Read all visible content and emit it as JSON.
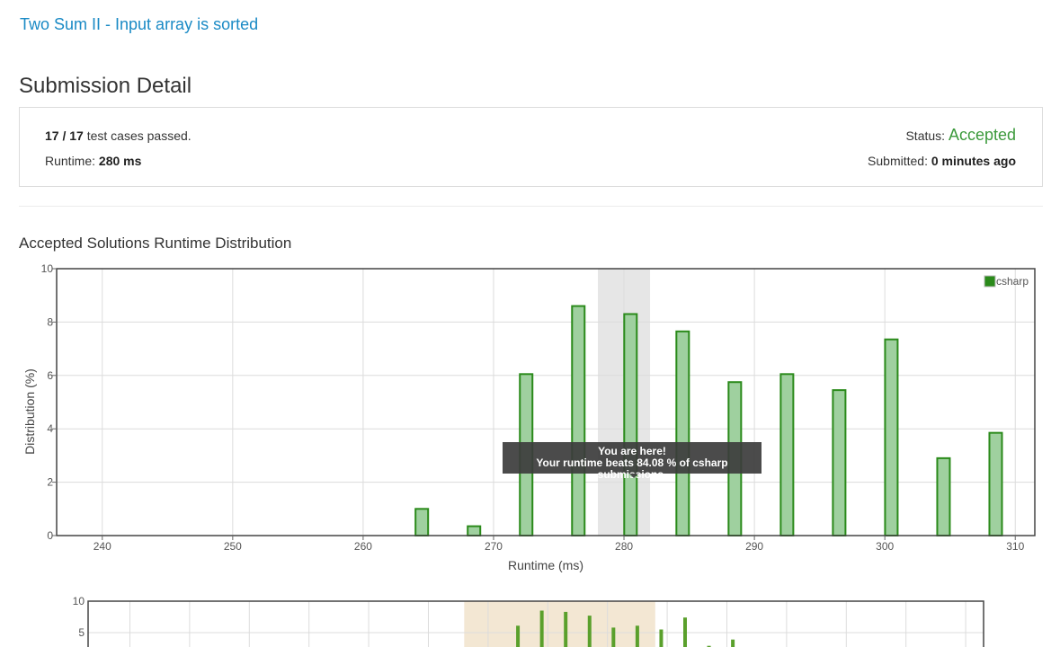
{
  "problem": {
    "title": "Two Sum II - Input array is sorted"
  },
  "page": {
    "title": "Submission Detail"
  },
  "detail": {
    "passed": "17",
    "total": "17",
    "sep": " / ",
    "cases_suffix": " test cases passed.",
    "runtime_label": "Runtime: ",
    "runtime_value": "280 ms",
    "status_label": "Status: ",
    "status_value": "Accepted",
    "submitted_label": "Submitted: ",
    "submitted_value": "0 minutes ago"
  },
  "section": {
    "title": "Accepted Solutions Runtime Distribution"
  },
  "tooltip": {
    "line1": "You are here!",
    "line2": "Your runtime beats 84.08 % of csharp submissions."
  },
  "colors": {
    "bar_fill": "#9fd09f",
    "bar_stroke": "#2a8a1a",
    "highlight_band": "#e6e6e6",
    "nav_band": "#f3e7d3",
    "nav_bar": "#5aa02c",
    "grid": "#dcdcdc"
  },
  "chart_data": [
    {
      "type": "bar",
      "title": "",
      "xlabel": "Runtime (ms)",
      "ylabel": "Distribution (%)",
      "xlim": [
        236.5,
        311.5
      ],
      "ylim": [
        0,
        10
      ],
      "xticks": [
        240,
        250,
        260,
        270,
        280,
        290,
        300,
        310
      ],
      "yticks": [
        0,
        2,
        4,
        6,
        8,
        10
      ],
      "legend": {
        "position": "top-right",
        "label": "csharp"
      },
      "highlight": {
        "from": 278,
        "to": 282
      },
      "series": [
        {
          "name": "csharp",
          "x": [
            264.5,
            268.5,
            272.5,
            276.5,
            280.5,
            284.5,
            288.5,
            292.5,
            296.5,
            300.5,
            304.5,
            308.5
          ],
          "values": [
            1.0,
            0.35,
            6.05,
            8.6,
            8.3,
            7.65,
            5.75,
            6.05,
            5.45,
            7.35,
            2.9,
            3.85
          ]
        }
      ]
    },
    {
      "type": "bar",
      "title": "",
      "ylim": [
        0,
        10
      ],
      "yticks": [
        5,
        10
      ],
      "highlight": {
        "from": 268,
        "to": 284
      },
      "series": [
        {
          "name": "",
          "x": [
            272.5,
            274.5,
            276.5,
            278.5,
            280.5,
            282.5,
            284.5,
            286.5,
            288.5,
            290.5
          ],
          "values": [
            6.1,
            8.5,
            8.3,
            7.7,
            5.8,
            6.1,
            5.5,
            7.4,
            2.9,
            3.9
          ]
        }
      ]
    }
  ]
}
